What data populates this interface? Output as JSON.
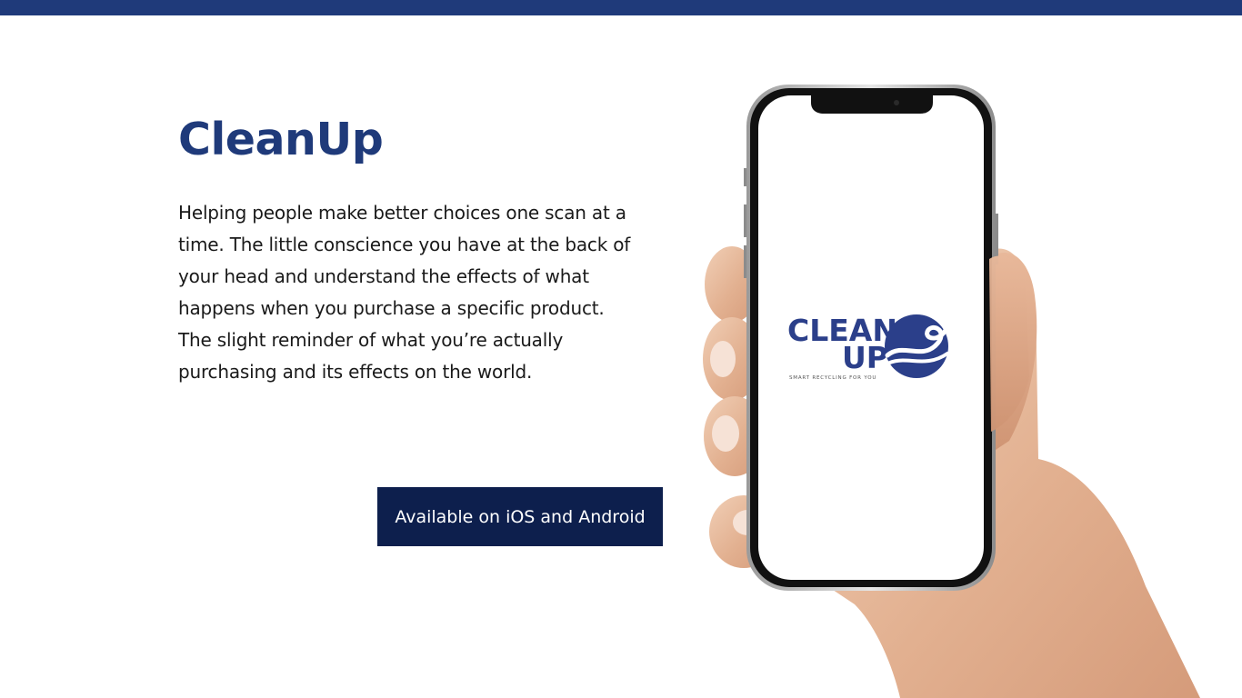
{
  "app": {
    "title": "CleanUp",
    "description": "Helping people make better choices one scan at a time. The little conscience you have at the back of your head and understand the effects of what happens when you purchase a specific product. The slight reminder of what you’re actually purchasing and its effects on the world."
  },
  "cta": {
    "label": "Available on iOS and Android"
  },
  "phone_logo": {
    "line1": "CLEAN",
    "line2": "UP",
    "tagline": "SMART RECYCLING FOR YOU"
  },
  "colors": {
    "brand": "#1f3a7a",
    "button": "#0d1f4d",
    "text": "#1a1a1a",
    "background": "#ffffff"
  },
  "icons": {
    "logo_mark": "wave-icon"
  }
}
